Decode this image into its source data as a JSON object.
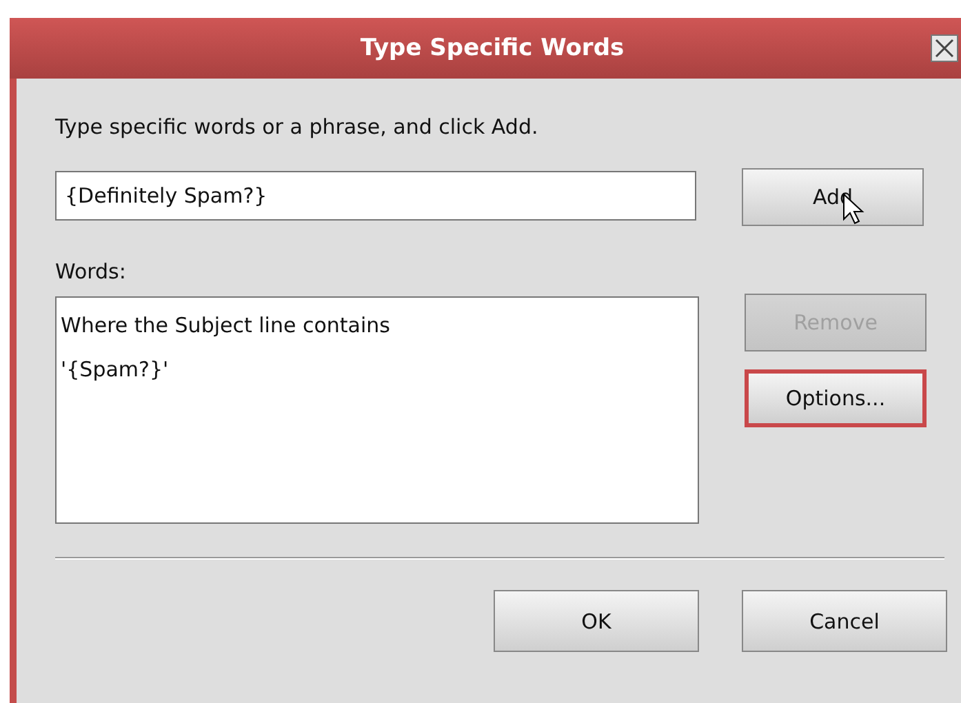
{
  "window": {
    "title": "Type Specific Words"
  },
  "instruction": "Type specific words or a phrase, and click Add.",
  "phrase_field": {
    "value": "{Definitely Spam?}"
  },
  "words_label": "Words:",
  "words_list": {
    "lines": [
      "Where the Subject line contains",
      "'{Spam?}'"
    ]
  },
  "side_buttons": [
    {
      "label": "Add",
      "disabled": false,
      "focused": false
    },
    {
      "label": "Remove",
      "disabled": true,
      "focused": false
    },
    {
      "label": "Options...",
      "disabled": false,
      "focused": true
    }
  ],
  "footer_buttons": [
    {
      "label": "OK",
      "disabled": false,
      "focused": false
    },
    {
      "label": "Cancel",
      "disabled": false,
      "focused": false
    }
  ]
}
